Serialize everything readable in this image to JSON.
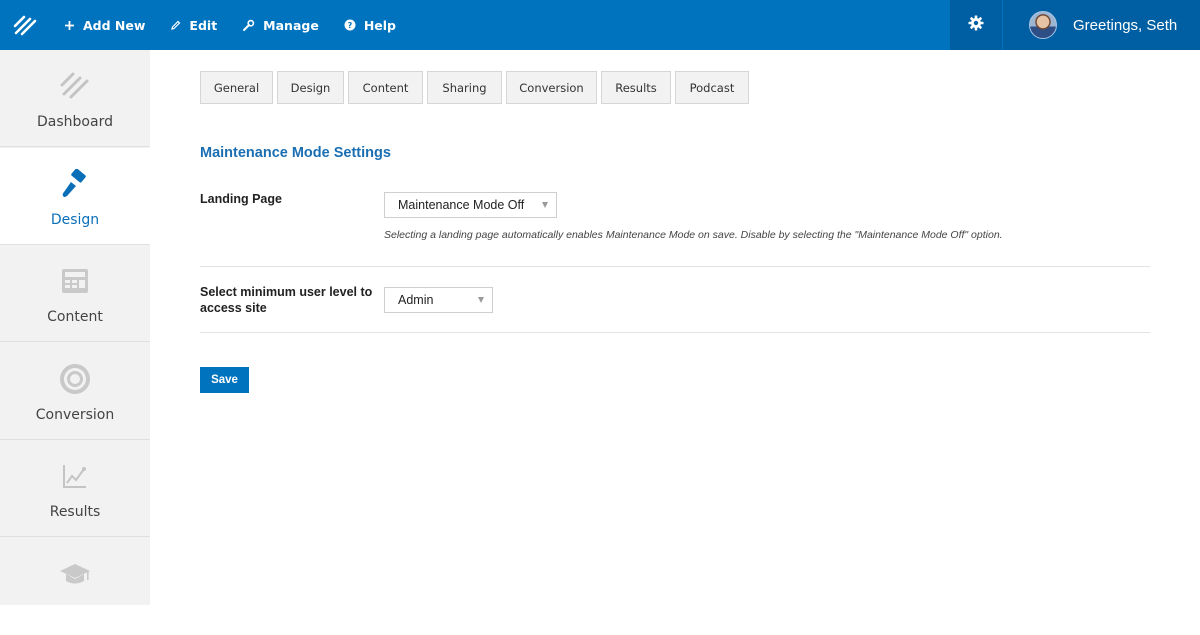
{
  "topbar": {
    "logo_icon": "thrive-logo-icon",
    "nav": [
      {
        "label": "Add New",
        "icon": "plus-icon"
      },
      {
        "label": "Edit",
        "icon": "pencil-icon"
      },
      {
        "label": "Manage",
        "icon": "wrench-icon"
      },
      {
        "label": "Help",
        "icon": "help-circle-icon"
      }
    ],
    "settings_icon": "gear-icon",
    "greeting": "Greetings, Seth",
    "accent_color": "#0073bf",
    "dark_accent_color": "#005fa3"
  },
  "sidebar": {
    "items": [
      {
        "label": "Dashboard",
        "icon": "stripes-logo-icon",
        "active": false
      },
      {
        "label": "Design",
        "icon": "paint-brush-icon",
        "active": true
      },
      {
        "label": "Content",
        "icon": "layout-grid-icon",
        "active": false
      },
      {
        "label": "Conversion",
        "icon": "target-icon",
        "active": false
      },
      {
        "label": "Results",
        "icon": "line-chart-icon",
        "active": false
      },
      {
        "label": "",
        "icon": "graduation-cap-icon",
        "active": false
      }
    ]
  },
  "tabs": [
    "General",
    "Design",
    "Content",
    "Sharing",
    "Conversion",
    "Results",
    "Podcast"
  ],
  "main": {
    "section_title": "Maintenance Mode Settings",
    "landing_page": {
      "label": "Landing Page",
      "value": "Maintenance Mode Off",
      "hint": "Selecting a landing page automatically enables Maintenance Mode on save. Disable by selecting the \"Maintenance Mode Off\" option."
    },
    "user_level": {
      "label_line1": "Select minimum user level to",
      "label_line2": "access site",
      "value": "Admin"
    },
    "save_label": "Save"
  }
}
